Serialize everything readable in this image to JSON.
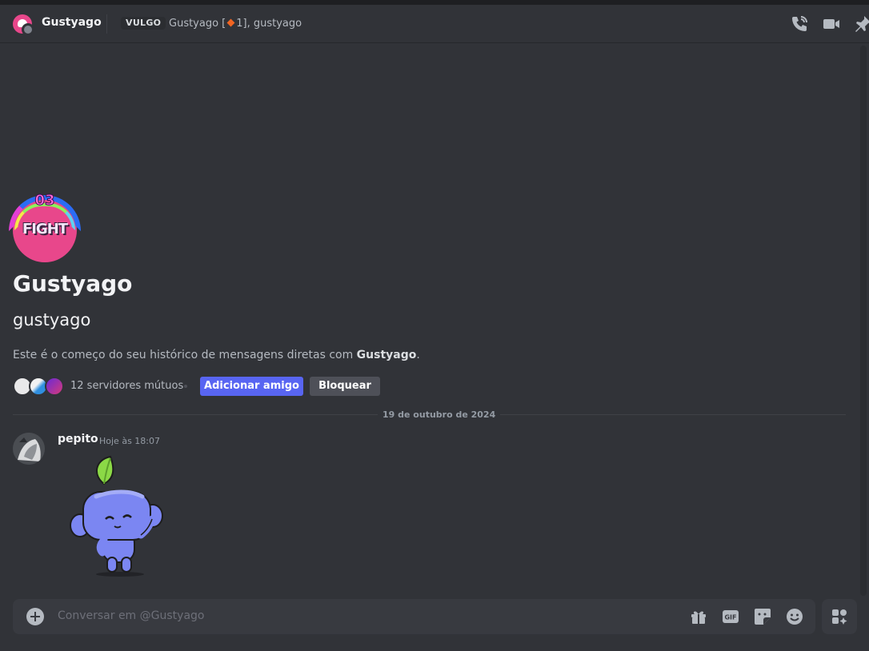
{
  "header": {
    "name": "Gustyago",
    "tag": "VULGO",
    "subtitle_prefix": "Gustyago [",
    "subtitle_suffix": "1], gustyago"
  },
  "header_icons": [
    "voice-call-icon",
    "video-call-icon",
    "pin-icon"
  ],
  "profile": {
    "decoration_number": "03",
    "decoration_word": "FIGHT",
    "display_name": "Gustyago",
    "username": "gustyago",
    "intro_text": "Este é o começo do seu histórico de mensagens diretas com ",
    "intro_name": "Gustyago",
    "intro_end": ".",
    "mutual_servers": "12 servidores mútuos",
    "add_friend_label": "Adicionar amigo",
    "block_label": "Bloquear"
  },
  "date_divider": "19 de outubro de 2024",
  "message": {
    "author": "pepito",
    "timestamp": "Hoje às 18:07",
    "sticker": "wumpus-leaf-sticker"
  },
  "composer": {
    "placeholder": "Conversar em @Gustyago",
    "icons": [
      "gift-icon",
      "gif-icon",
      "sticker-icon",
      "emoji-icon",
      "apps-icon"
    ],
    "gif_label": "GIF"
  },
  "colors": {
    "background": "#313338",
    "brand": "#5865f2",
    "secondary_button": "#4e5058",
    "avatar_pink": "#e8478b"
  }
}
